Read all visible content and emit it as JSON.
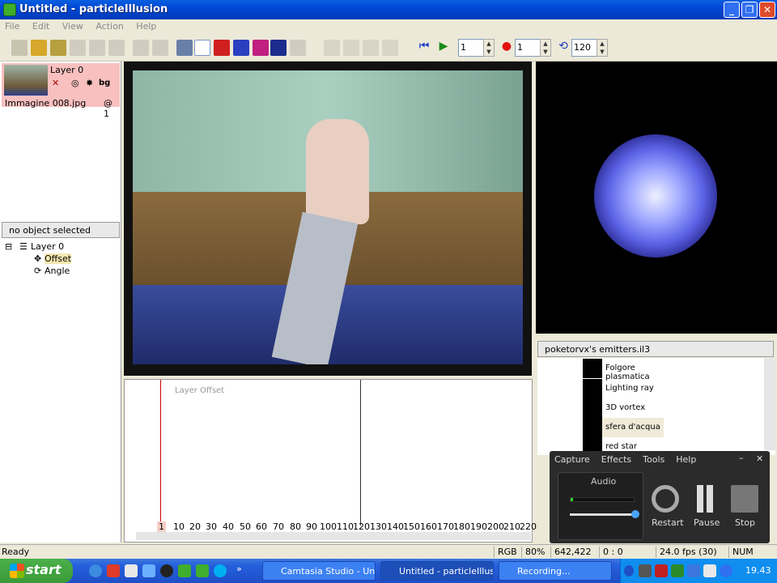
{
  "window": {
    "title": "Untitled - particleIllusion"
  },
  "menubar": [
    "File",
    "Edit",
    "View",
    "Action",
    "Help"
  ],
  "toolbar": {
    "frame_value": "1",
    "record_value": "1",
    "loop_value": "120"
  },
  "layers": {
    "layer_name": "Layer 0",
    "image_name": "Immagine 008.jpg",
    "frame_ref": "@ 1",
    "thumb_buttons": [
      "bg"
    ]
  },
  "object_panel": {
    "header": "no object selected",
    "tree_root": "Layer 0",
    "children": [
      "Offset",
      "Angle"
    ]
  },
  "timeline": {
    "track_label": "Layer Offset",
    "ticks": [
      "1",
      "10",
      "20",
      "30",
      "40",
      "50",
      "60",
      "70",
      "80",
      "90",
      "100",
      "110",
      "120",
      "130",
      "140",
      "150",
      "160",
      "170",
      "180",
      "190",
      "200",
      "210",
      "220"
    ]
  },
  "emitters": {
    "library": "poketorvx's emitters.il3",
    "items": [
      "Folgore plasmatica",
      "Lighting ray",
      "3D vortex",
      "sfera d'acqua",
      "red star"
    ],
    "selected": "sfera d'acqua"
  },
  "camtasia": {
    "menu": [
      "Capture",
      "Effects",
      "Tools",
      "Help"
    ],
    "audio_label": "Audio",
    "restart": "Restart",
    "pause": "Pause",
    "stop": "Stop",
    "min": "–",
    "close": "✕"
  },
  "status": {
    "ready": "Ready",
    "color_mode": "RGB",
    "zoom": "80%",
    "coords": "642,422",
    "offset": "0 : 0",
    "fps": "24.0 fps (30)",
    "num": "NUM"
  },
  "taskbar": {
    "start": "start",
    "tasks": [
      "Camtasia Studio - Un...",
      "Untitled - particleIllus...",
      "Recording..."
    ],
    "clock": "19.43"
  }
}
